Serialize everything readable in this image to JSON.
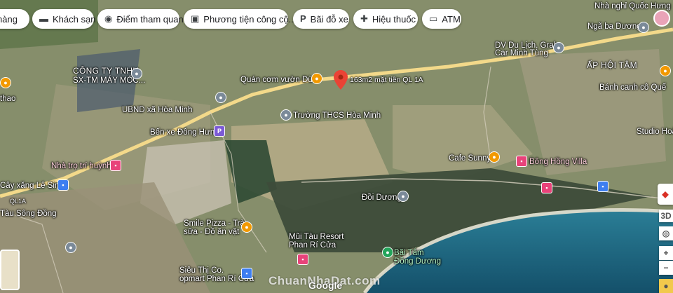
{
  "chips": [
    {
      "icon": "hotel-icon",
      "label": "hàng"
    },
    {
      "icon": "bed-icon",
      "label": "Khách sạn"
    },
    {
      "icon": "camera-icon",
      "label": "Điểm tham quan"
    },
    {
      "icon": "bus-icon",
      "label": "Phương tiện công cộ..."
    },
    {
      "icon": "parking-icon",
      "label": "Bãi đỗ xe"
    },
    {
      "icon": "pharmacy-icon",
      "label": "Hiệu thuốc"
    },
    {
      "icon": "atm-icon",
      "label": "ATM"
    }
  ],
  "places": {
    "cty": "CÔNG TY TNHH",
    "cty2": "SX-TM MÁY MÓC...",
    "ubnd": "UBND xã Hòa Minh",
    "benxe": "Bến xe Đông Hưng",
    "nhatro": "Nhà trọ trí huỳnh",
    "cayxang": "Cây xăng Lê Sinh",
    "songdong": "Tàu Sông Đồng",
    "thao": "thao",
    "quancom": "Quán cơm vườn Dừa",
    "ql1a_label": "QL1A",
    "mattien": "163m2 mặt tiền QL 1A",
    "truong": "Trường THCS Hòa Minh",
    "nhanghi": "Nhà nghỉ Quốc Hưng",
    "ngabaduong": "Ngã ba Dương",
    "dulich": "DV Du Lịch, Grab",
    "dulich2": "Car Minh Tùng",
    "aphoitam": "ẤP HỘI TÂM",
    "banhcanh": "Bánh canh cô Quế",
    "studio": "Studio Hoà",
    "cafe": "Cafe Sunny",
    "bonghong": "Bông Hồng Villa",
    "doiduong": "Đồi Dương",
    "smile": "Smile Pizza - Trà",
    "smile2": "sữa - Đồ ăn vặt",
    "muitau": "Mũi Tàu Resort",
    "muitau2": "Phan Rí Cửa",
    "baitam": "Bãi Tắm",
    "baitam2": "Đồng Dương",
    "sieuthi": "Siêu Thị Co.",
    "sieuthi2": "opmart Phan Rí Cửa"
  },
  "controls": {
    "view3d": "3D"
  },
  "watermark": "ChuanNhaDat.com",
  "google": "Google",
  "colors": {
    "road": "#f3d98a",
    "sea": "#1f6f8b",
    "land": "#7d8a62"
  }
}
